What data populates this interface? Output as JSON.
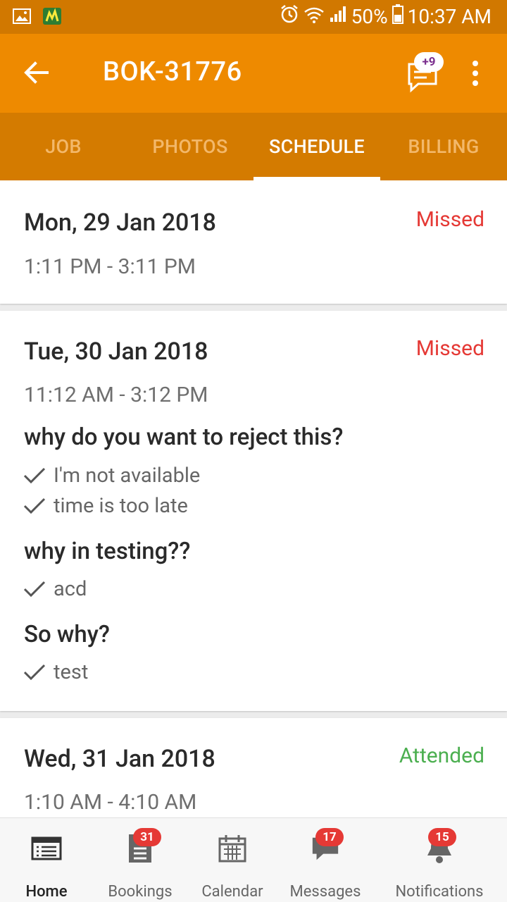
{
  "status_bar": {
    "battery": "50%",
    "time": "10:37 AM"
  },
  "app_bar": {
    "title": "BOK-31776",
    "chat_badge": "+9"
  },
  "tabs": [
    {
      "label": "JOB"
    },
    {
      "label": "PHOTOS"
    },
    {
      "label": "SCHEDULE"
    },
    {
      "label": "BILLING"
    }
  ],
  "schedule": [
    {
      "date": "Mon, 29 Jan 2018",
      "time": "1:11 PM - 3:11 PM",
      "status": "Missed",
      "questions": []
    },
    {
      "date": "Tue, 30 Jan 2018",
      "time": "11:12 AM - 3:12 PM",
      "status": "Missed",
      "questions": [
        {
          "q": "why do you want to reject this?",
          "answers": [
            "I'm not available",
            "time is too late"
          ]
        },
        {
          "q": "why in testing??",
          "answers": [
            "acd"
          ]
        },
        {
          "q": "So why?",
          "answers": [
            "test"
          ]
        }
      ]
    },
    {
      "date": "Wed, 31 Jan 2018",
      "time": "1:10 AM - 4:10 AM",
      "status": "Attended",
      "questions": []
    }
  ],
  "bottom_nav": [
    {
      "label": "Home",
      "icon": "home-list-icon",
      "badge": ""
    },
    {
      "label": "Bookings",
      "icon": "bookings-doc-icon",
      "badge": "31"
    },
    {
      "label": "Calendar",
      "icon": "calendar-icon",
      "badge": ""
    },
    {
      "label": "Messages",
      "icon": "messages-icon",
      "badge": "17"
    },
    {
      "label": "Notifications",
      "icon": "bell-icon",
      "badge": "15"
    }
  ],
  "colors": {
    "status_bar": "#d17800",
    "app_bar": "#ee8a00",
    "tab_bar": "#d47b00",
    "missed": "#e53935",
    "attended": "#4caf50",
    "badge": "#e53935"
  }
}
